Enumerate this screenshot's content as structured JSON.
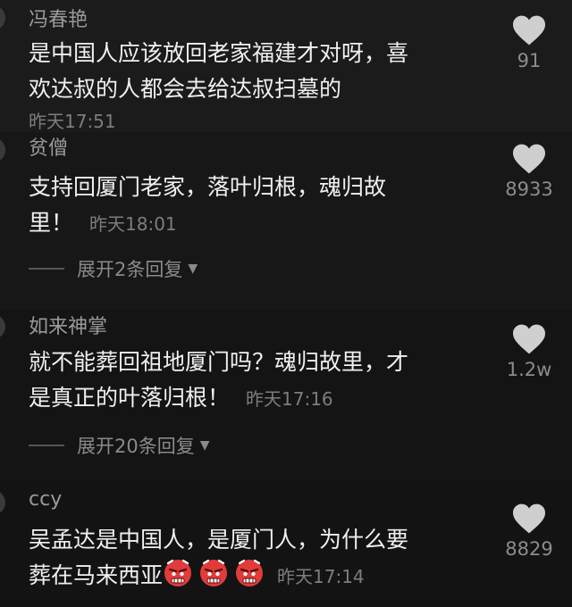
{
  "comments": [
    {
      "username": "冯春艳",
      "lines": [
        "是中国人应该放回老家福建才对呀，喜",
        "欢达叔的人都会去给达叔扫墓的"
      ],
      "time": "昨天17:51",
      "likes": "91"
    },
    {
      "username": "贫僧",
      "lines": [
        "支持回厦门老家，落叶归根，魂归故",
        "里！"
      ],
      "time": "昨天18:01",
      "likes": "8933",
      "expand": "展开2条回复"
    },
    {
      "username": "如来神掌",
      "lines": [
        "就不能葬回祖地厦门吗？魂归故里，才",
        "是真正的叶落归根！"
      ],
      "time": "昨天17:16",
      "likes": "1.2w",
      "expand": "展开20条回复"
    },
    {
      "username": "ccy",
      "lines": [
        "吴孟达是中国人，是厦门人，为什么要",
        "葬在马来西亚"
      ],
      "time": "昨天17:14",
      "likes": "8829",
      "emoji": [
        "angry-face-emoji",
        "angry-face-emoji",
        "angry-face-emoji"
      ]
    }
  ],
  "icons": {
    "like": "heart-icon",
    "expand": "caret-down-icon"
  },
  "colors": {
    "background": "#161616",
    "text": "#f0f0f0",
    "meta": "#7d7d7d",
    "emoji_red": "#e23b3b"
  }
}
